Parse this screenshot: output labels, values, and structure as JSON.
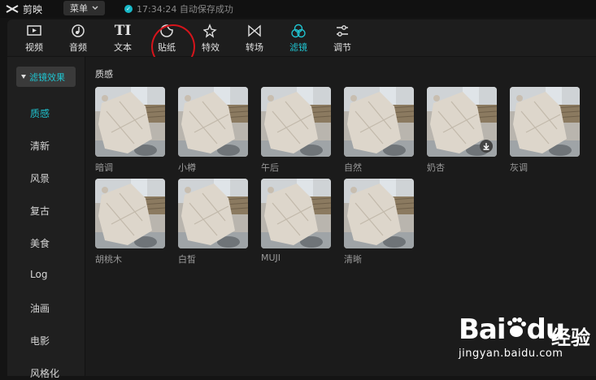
{
  "titlebar": {
    "app_name": "剪映",
    "menu_label": "菜单",
    "save_status": "17:34:24 自动保存成功"
  },
  "toolbar": {
    "tools": [
      {
        "label": "视频",
        "icon": "video-icon"
      },
      {
        "label": "音频",
        "icon": "audio-icon"
      },
      {
        "label": "文本",
        "icon": "text-icon"
      },
      {
        "label": "贴纸",
        "icon": "sticker-icon"
      },
      {
        "label": "特效",
        "icon": "effects-icon"
      },
      {
        "label": "转场",
        "icon": "transition-icon"
      },
      {
        "label": "滤镜",
        "icon": "filter-icon",
        "active": true
      },
      {
        "label": "调节",
        "icon": "adjust-icon"
      }
    ],
    "accent_color": "#20c3cf"
  },
  "sidebar": {
    "header": "滤镜效果",
    "items": [
      "质感",
      "清新",
      "风景",
      "复古",
      "美食",
      "Log",
      "油画",
      "电影",
      "风格化"
    ],
    "active_item": "质感"
  },
  "main": {
    "section_title": "质感",
    "filters": [
      "暗调",
      "小樽",
      "午后",
      "自然",
      "奶杏",
      "灰调",
      "胡桃木",
      "白皙",
      "MUJI",
      "清晰"
    ]
  },
  "watermark": {
    "brand_left": "Bai",
    "brand_right": "du",
    "brand_cn": "经验",
    "url": "jingyan.baidu.com"
  }
}
